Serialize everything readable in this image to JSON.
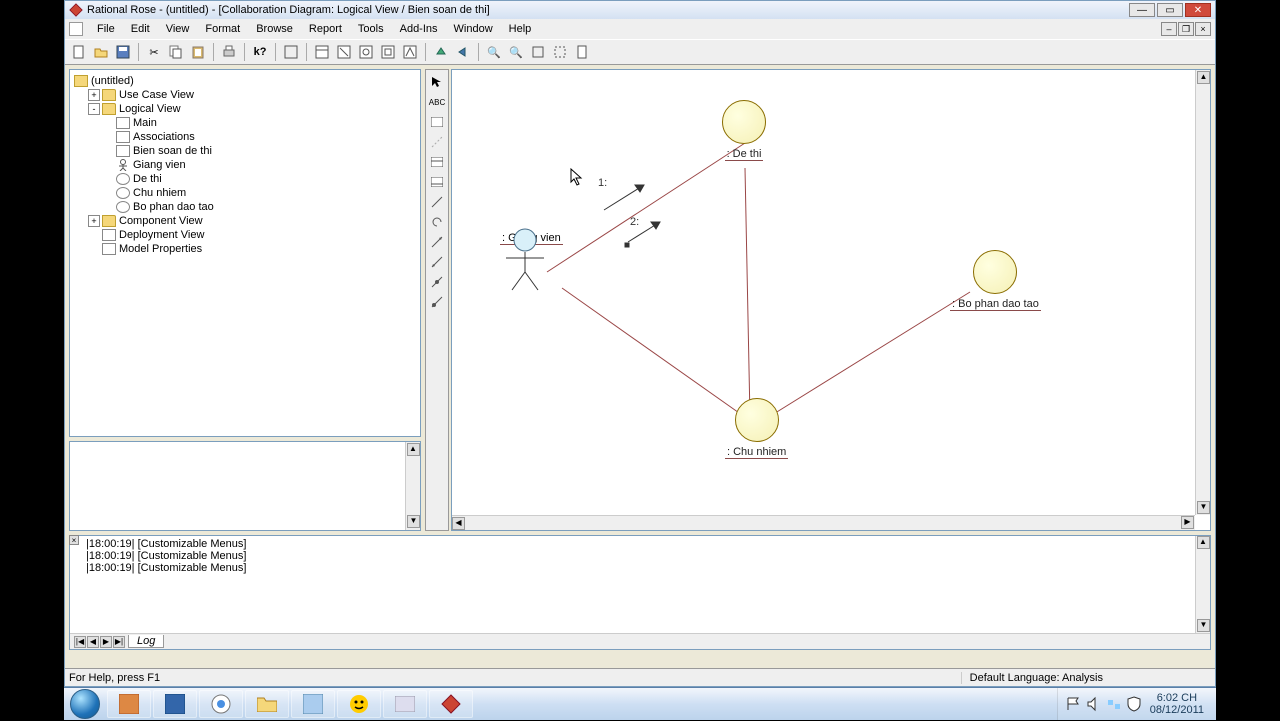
{
  "title": "Rational Rose - (untitled) - [Collaboration Diagram: Logical View / Bien soan de thi]",
  "menu": [
    "File",
    "Edit",
    "View",
    "Format",
    "Browse",
    "Report",
    "Tools",
    "Add-Ins",
    "Window",
    "Help"
  ],
  "tree": {
    "root": "(untitled)",
    "items": [
      {
        "label": "Use Case View",
        "depth": 1,
        "tw": "+",
        "icon": "fold"
      },
      {
        "label": "Logical View",
        "depth": 1,
        "tw": "-",
        "icon": "fold"
      },
      {
        "label": "Main",
        "depth": 2,
        "icon": "dgm"
      },
      {
        "label": "Associations",
        "depth": 2,
        "icon": "dgm"
      },
      {
        "label": "Bien soan de thi",
        "depth": 2,
        "icon": "dgm"
      },
      {
        "label": "Giang vien",
        "depth": 2,
        "icon": "actor"
      },
      {
        "label": "De thi",
        "depth": 2,
        "icon": "obj"
      },
      {
        "label": "Chu nhiem",
        "depth": 2,
        "icon": "obj"
      },
      {
        "label": "Bo phan dao tao",
        "depth": 2,
        "icon": "obj"
      },
      {
        "label": "Component View",
        "depth": 1,
        "tw": "+",
        "icon": "fold"
      },
      {
        "label": "Deployment View",
        "depth": 1,
        "icon": "dgm"
      },
      {
        "label": "Model Properties",
        "depth": 1,
        "icon": "dgm"
      }
    ]
  },
  "diagram": {
    "nodes": {
      "de_thi": {
        "label": ": De thi"
      },
      "giang_vien": {
        "label": ": Giang vien"
      },
      "bo_phan": {
        "label": ": Bo phan dao tao"
      },
      "chu_nhiem": {
        "label": ": Chu nhiem"
      }
    },
    "messages": {
      "m1": "1:",
      "m2": "2:"
    }
  },
  "log": {
    "lines": [
      "|18:00:19|  [Customizable Menus]",
      "|18:00:19|  [Customizable Menus]",
      "|18:00:19|  [Customizable Menus]"
    ],
    "tab": "Log"
  },
  "status": {
    "left": "For Help, press F1",
    "right": "Default Language: Analysis"
  },
  "taskbar": {
    "time": "6:02 CH",
    "date": "08/12/2011"
  }
}
